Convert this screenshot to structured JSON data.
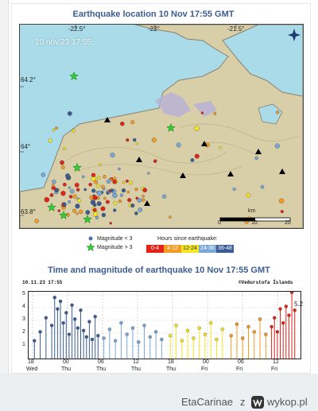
{
  "map": {
    "title": "Earthquake location   10 Nov 17:55 GMT",
    "timestamp_label": "10.nóv.23  17:55",
    "lon_labels": [
      "-22.5°",
      "-22°",
      "-21.5°"
    ],
    "lat_labels": [
      "64.2°",
      "64°",
      "63.8°"
    ],
    "scale_unit": "km",
    "scale_ticks": [
      "0",
      "10",
      "20"
    ],
    "legend": {
      "mag_small": "Magnitude < 3",
      "mag_large": "Magnitude > 3",
      "hours_title": "Hours since earthquake:",
      "bins": [
        {
          "label": "0-4",
          "color": "#e2231a"
        },
        {
          "label": "4-12",
          "color": "#f59a23"
        },
        {
          "label": "12-24",
          "color": "#f5e623"
        },
        {
          "label": "24-36",
          "color": "#7aa6d8"
        },
        {
          "label": "36-48",
          "color": "#3b5c93"
        }
      ]
    },
    "colors": {
      "sea": "#a9dbe9",
      "land": "#d8cfa8",
      "lava": "#b7b2d6",
      "star": "#33cc33"
    }
  },
  "chart": {
    "title": "Time and magnitude of earthquake   10 Nov 17:55 GMT",
    "timestamp": "10.11.23 17:55",
    "credit": "©Veðurstofa Íslands",
    "y_ticks": [
      "1",
      "2",
      "3",
      "4",
      "5"
    ],
    "x_ticks": [
      {
        "time": "18",
        "day": "Wed"
      },
      {
        "time": "00",
        "day": "Thu"
      },
      {
        "time": "06",
        "day": "Thu"
      },
      {
        "time": "12",
        "day": "Thu"
      },
      {
        "time": "18",
        "day": "Thu"
      },
      {
        "time": "00",
        "day": "Fri"
      },
      {
        "time": "06",
        "day": "Fri"
      },
      {
        "time": "12",
        "day": "Fri"
      }
    ],
    "last_value_label": "5.2"
  },
  "chart_data": {
    "type": "scatter",
    "title": "Time and magnitude of earthquake   10 Nov 17:55 GMT",
    "x_unit": "hours",
    "y_range": [
      0,
      5
    ],
    "series": [
      {
        "name": "36-48",
        "color": "#3b5c93",
        "points": [
          [
            2,
            1.4
          ],
          [
            4,
            2.1
          ],
          [
            6,
            3.2
          ],
          [
            8,
            2.6
          ],
          [
            9,
            4.8
          ],
          [
            10,
            3.9
          ],
          [
            11,
            4.5
          ],
          [
            12,
            2.8
          ],
          [
            13,
            3.6
          ],
          [
            14,
            1.9
          ],
          [
            15,
            4.2
          ],
          [
            16,
            3.1
          ],
          [
            17,
            2.4
          ],
          [
            18,
            3.8
          ],
          [
            19,
            2.2
          ],
          [
            20,
            1.7
          ],
          [
            21,
            2.9
          ],
          [
            22,
            1.5
          ],
          [
            23,
            3.3
          ],
          [
            24,
            1.8
          ]
        ]
      },
      {
        "name": "24-36",
        "color": "#7aa6d8",
        "points": [
          [
            26,
            1.6
          ],
          [
            28,
            2.3
          ],
          [
            30,
            1.4
          ],
          [
            32,
            2.8
          ],
          [
            34,
            1.9
          ],
          [
            36,
            2.4
          ],
          [
            38,
            1.3
          ],
          [
            40,
            2.6
          ],
          [
            42,
            1.7
          ],
          [
            44,
            2.1
          ],
          [
            46,
            1.5
          ]
        ]
      },
      {
        "name": "12-24",
        "color": "#f5e623",
        "points": [
          [
            49,
            1.8
          ],
          [
            51,
            2.6
          ],
          [
            53,
            1.4
          ],
          [
            55,
            2.2
          ],
          [
            57,
            1.6
          ],
          [
            59,
            2.4
          ],
          [
            61,
            1.9
          ],
          [
            63,
            2.8
          ],
          [
            65,
            1.5
          ],
          [
            67,
            2.3
          ]
        ]
      },
      {
        "name": "4-12",
        "color": "#f59a23",
        "points": [
          [
            70,
            1.8
          ],
          [
            72,
            2.7
          ],
          [
            74,
            1.6
          ],
          [
            76,
            2.5
          ],
          [
            78,
            2.1
          ],
          [
            80,
            3.1
          ],
          [
            82,
            1.9
          ]
        ]
      },
      {
        "name": "0-4",
        "color": "#e2231a",
        "points": [
          [
            84,
            2.5
          ],
          [
            85,
            3.2
          ],
          [
            86,
            2.1
          ],
          [
            87,
            3.9
          ],
          [
            88,
            2.8
          ],
          [
            89,
            4.1
          ],
          [
            90,
            3.4
          ],
          [
            91,
            5.2
          ],
          [
            92,
            3.8
          ]
        ]
      }
    ],
    "x_ticks": [
      "18 Wed",
      "00 Thu",
      "06 Thu",
      "12 Thu",
      "18 Thu",
      "00 Fri",
      "06 Fri",
      "12 Fri"
    ],
    "y_ticks": [
      1,
      2,
      3,
      4,
      5
    ]
  },
  "footer": {
    "username": "EtaCarinae",
    "separator": "z",
    "site": "wykop.pl"
  }
}
